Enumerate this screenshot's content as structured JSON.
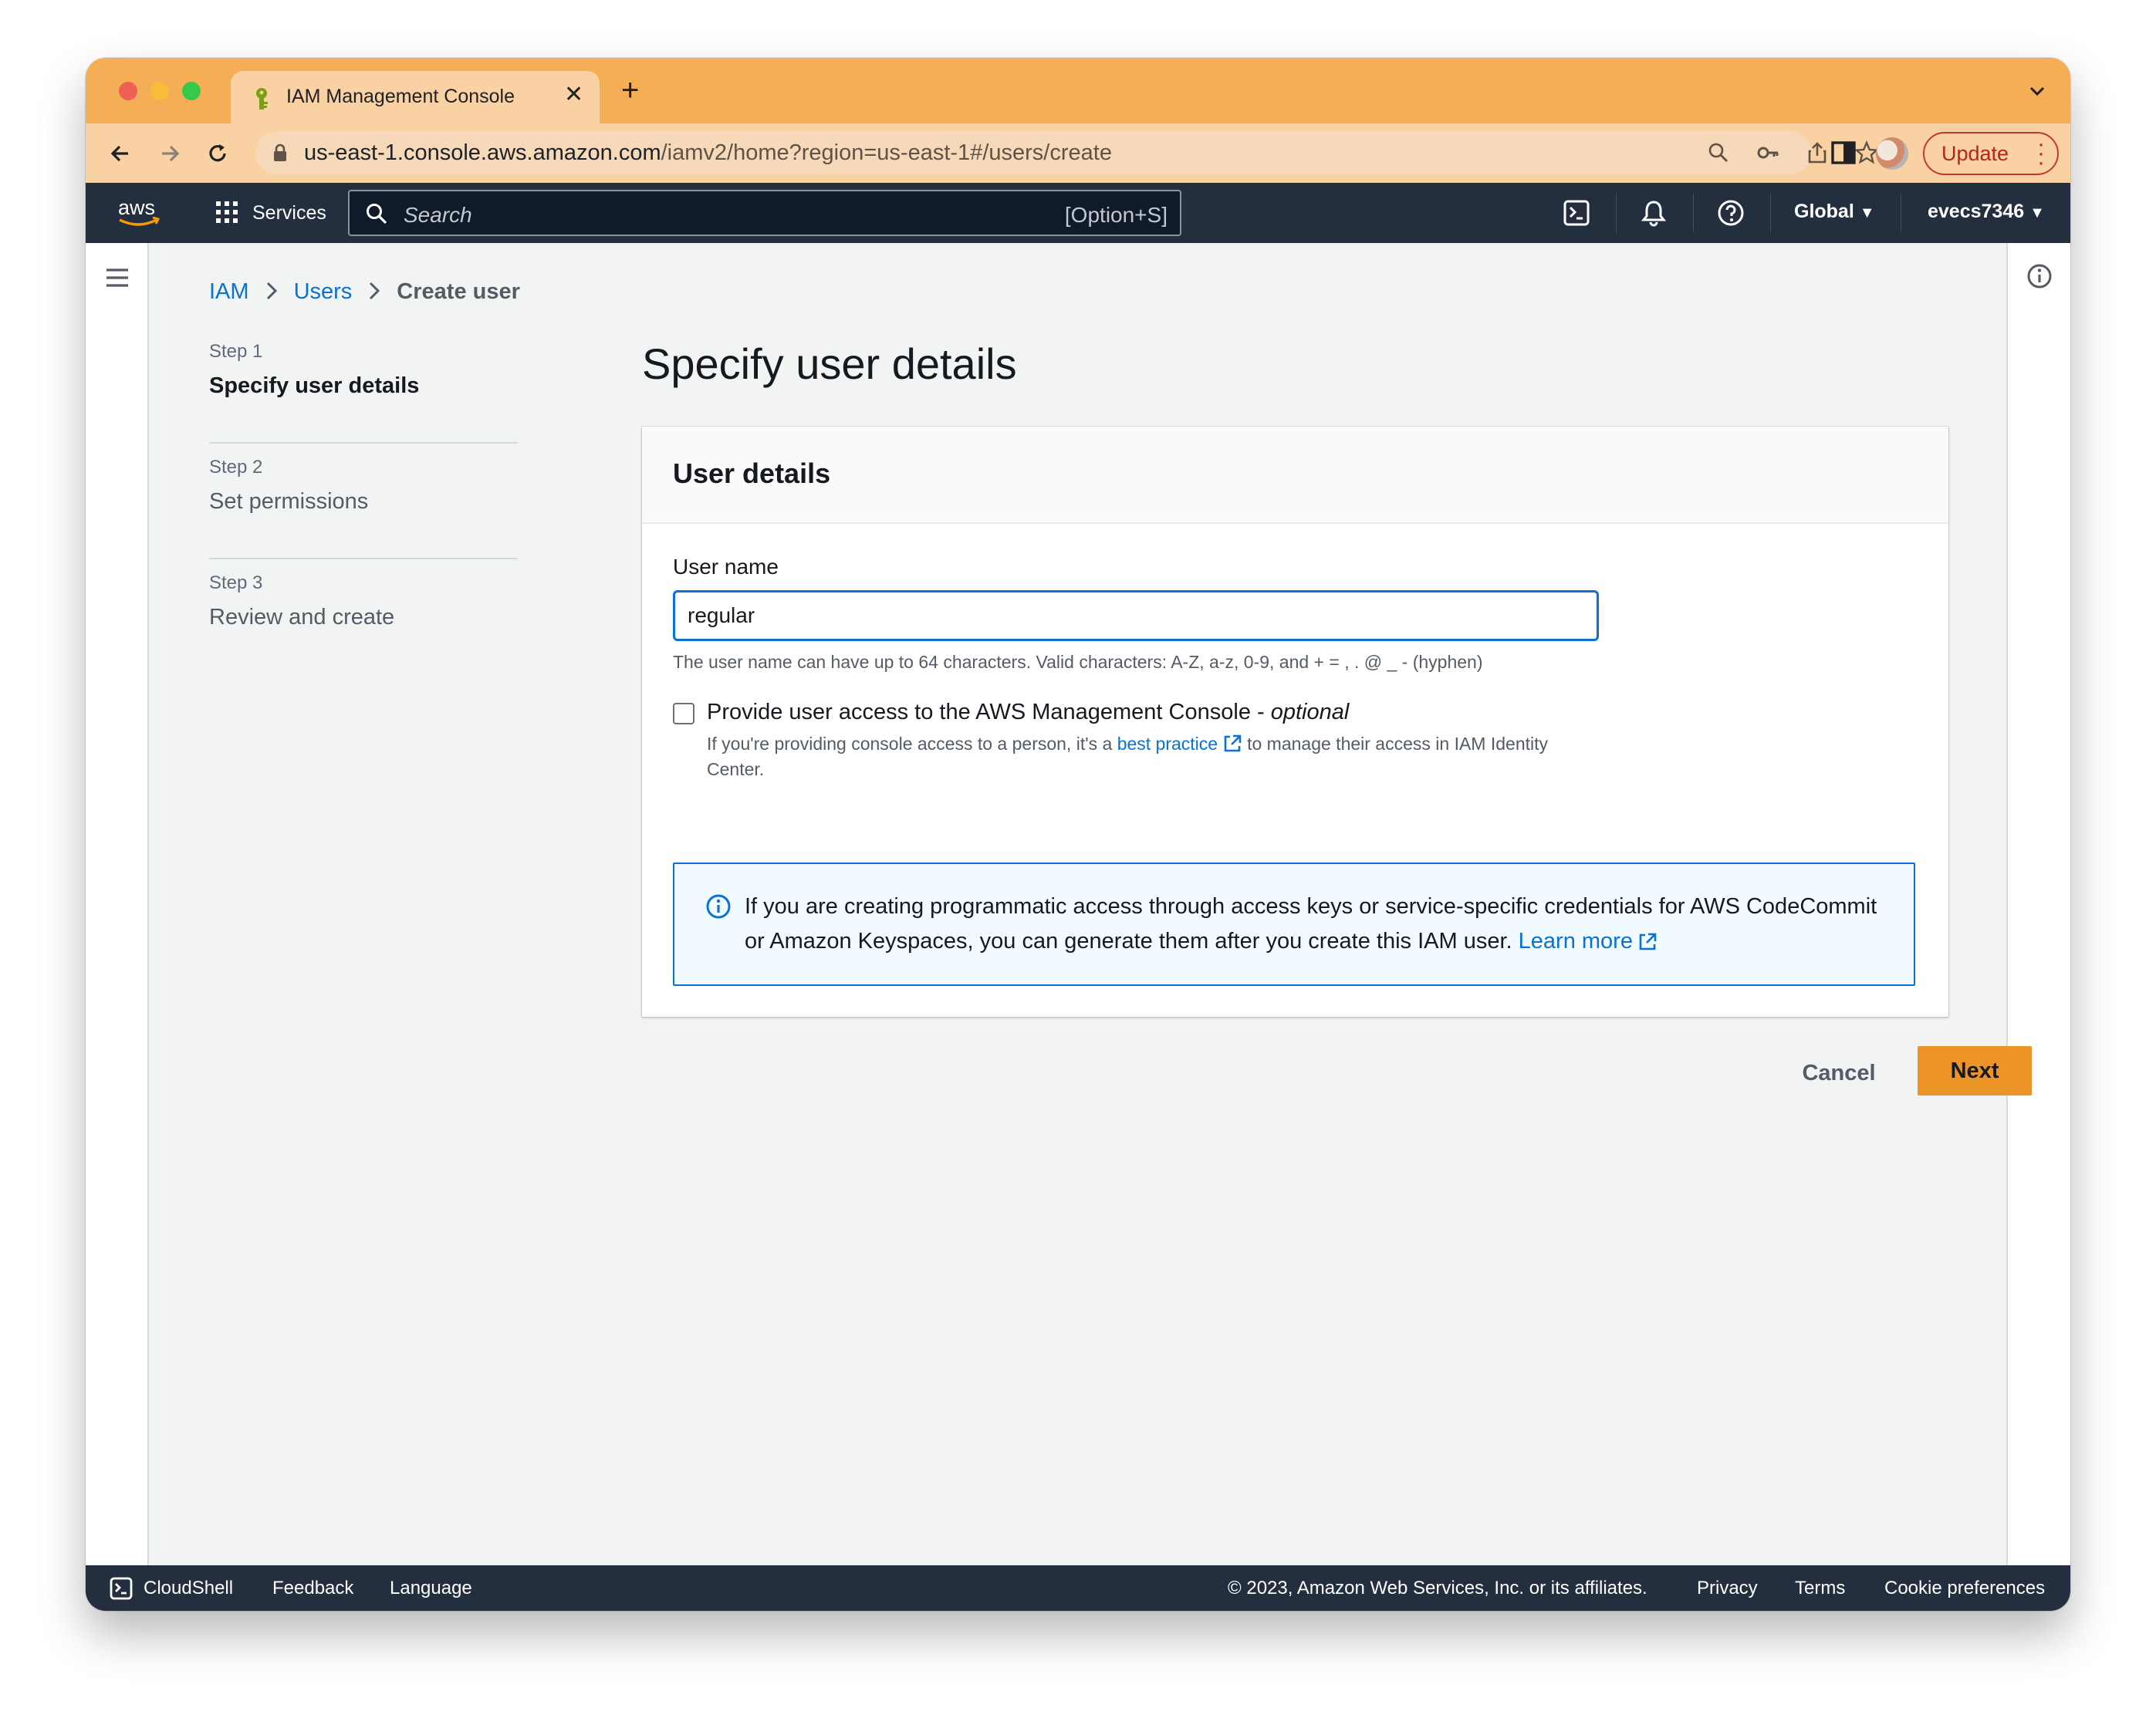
{
  "browser": {
    "tab_title": "IAM Management Console",
    "url_host": "us-east-1.console.aws.amazon.com",
    "url_path": "/iamv2/home?region=us-east-1#/users/create",
    "update_label": "Update"
  },
  "aws_header": {
    "services_label": "Services",
    "search_placeholder": "Search",
    "search_shortcut": "[Option+S]",
    "region_label": "Global",
    "account_label": "evecs7346"
  },
  "breadcrumb": {
    "items": [
      "IAM",
      "Users"
    ],
    "current": "Create user"
  },
  "steps": [
    {
      "number": "Step 1",
      "name": "Specify user details",
      "active": true
    },
    {
      "number": "Step 2",
      "name": "Set permissions",
      "active": false
    },
    {
      "number": "Step 3",
      "name": "Review and create",
      "active": false
    }
  ],
  "page_title": "Specify user details",
  "user_details": {
    "title": "User details",
    "username_label": "User name",
    "username_value": "regular",
    "username_hint": "The user name can have up to 64 characters. Valid characters: A-Z, a-z, 0-9, and + = , . @ _ - (hyphen)",
    "console_access_label": "Provide user access to the AWS Management Console - ",
    "console_access_optional": "optional",
    "console_access_desc_before": "If you're providing console access to a person, it's a",
    "console_access_link": "best practice",
    "console_access_desc_after": "to manage their access in IAM Identity Center.",
    "alert_text": "If you are creating programmatic access through access keys or service-specific credentials for AWS CodeCommit or Amazon Keyspaces, you can generate them after you create this IAM user.",
    "alert_link": "Learn more"
  },
  "actions": {
    "cancel_label": "Cancel",
    "next_label": "Next"
  },
  "footer": {
    "cloudshell_label": "CloudShell",
    "feedback_label": "Feedback",
    "language_label": "Language",
    "copyright": "© 2023, Amazon Web Services, Inc. or its affiliates.",
    "privacy_label": "Privacy",
    "terms_label": "Terms",
    "cookie_label": "Cookie preferences"
  },
  "colors": {
    "tab_bar": "#f4ae56",
    "aws_navy": "#232f3e",
    "primary_button": "#ec9427",
    "link_blue": "#0972d3"
  }
}
